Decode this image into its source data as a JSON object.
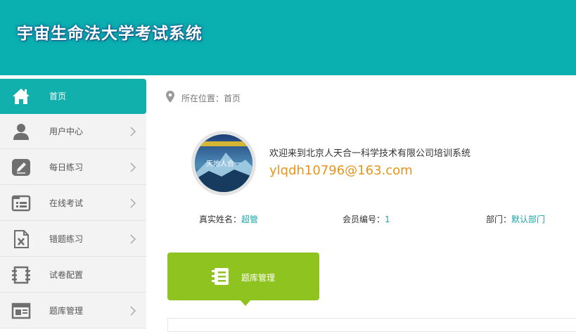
{
  "header": {
    "title": "宇宙生命法大学考试系统",
    "bg_color": "#0aafaf"
  },
  "sidebar": {
    "items": [
      {
        "label": "首页",
        "icon": "home-icon",
        "active": true
      },
      {
        "label": "用户中心",
        "icon": "user-icon"
      },
      {
        "label": "每日练习",
        "icon": "edit-icon"
      },
      {
        "label": "在线考试",
        "icon": "list-icon"
      },
      {
        "label": "错题练习",
        "icon": "excel-icon"
      },
      {
        "label": "试卷配置",
        "icon": "ruler-icon"
      },
      {
        "label": "题库管理",
        "icon": "newspaper-icon"
      }
    ]
  },
  "breadcrumb": {
    "text": "所在位置：首页",
    "icon": "location-pin-icon"
  },
  "profile": {
    "welcome": "欢迎来到北京人天合一科学技术有限公司培训系统",
    "email": "ylqdh10796@163.com",
    "real_name_label": "真实姓名：",
    "real_name": "超管",
    "member_id_label": "会员编号：",
    "member_id": "1",
    "department_label": "部门：",
    "department": "默认部门",
    "avatar_caption": "天地人合一"
  },
  "tile": {
    "label": "题库管理",
    "icon": "book-stack-icon",
    "color": "#8fc31f"
  },
  "colors": {
    "accent": "#11b0ac",
    "email": "#e8941b",
    "value": "#1aa5a5"
  }
}
